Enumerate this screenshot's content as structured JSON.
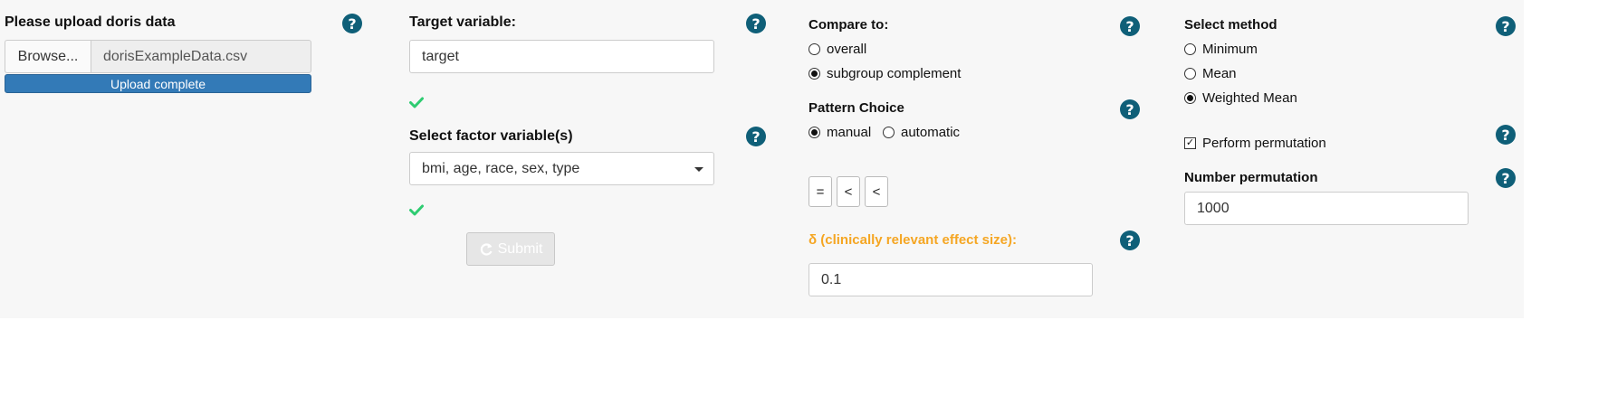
{
  "colors": {
    "panel_bg": "#f7f7f7",
    "help_icon": "#0f5f78",
    "progress": "#337ab7",
    "check": "#2ecc71",
    "delta_label": "#f5a623"
  },
  "upload": {
    "label": "Please upload doris data",
    "browse_label": "Browse...",
    "file_name": "dorisExampleData.csv",
    "progress_text": "Upload complete",
    "progress_fraction": 1.0
  },
  "target": {
    "label": "Target variable:",
    "value": "target"
  },
  "factors": {
    "label": "Select factor variable(s)",
    "value": "bmi, age, race, sex, type"
  },
  "submit": {
    "label": "Submit",
    "icon": "refresh-icon"
  },
  "compare": {
    "label": "Compare to:",
    "options": [
      "overall",
      "subgroup complement"
    ],
    "selected": "subgroup complement"
  },
  "pattern": {
    "label": "Pattern Choice",
    "options": [
      "manual",
      "automatic"
    ],
    "selected": "manual",
    "symbols": [
      "=",
      "<",
      "<"
    ]
  },
  "delta": {
    "label": "δ (clinically relevant effect size):",
    "value": "0.1"
  },
  "method": {
    "label": "Select method",
    "options": [
      "Minimum",
      "Mean",
      "Weighted Mean"
    ],
    "selected": "Weighted Mean"
  },
  "permutation": {
    "checkbox_label": "Perform permutation",
    "checked": true,
    "number_label": "Number permutation",
    "number_value": "1000"
  }
}
